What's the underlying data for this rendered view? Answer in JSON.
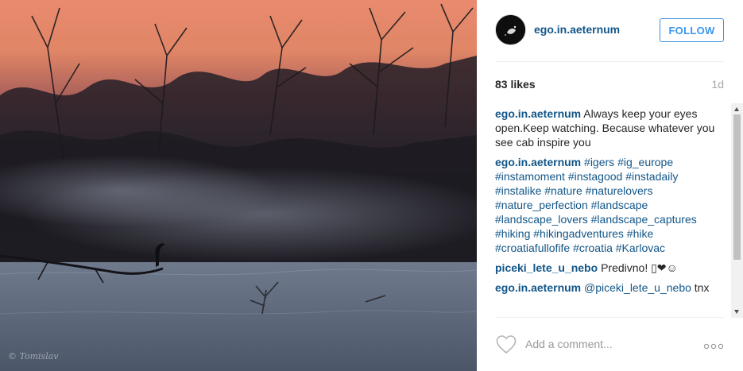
{
  "photo": {
    "watermark": "© Tomislav"
  },
  "post": {
    "author": "ego.in.aeternum",
    "follow_label": "FOLLOW",
    "likes": "83 likes",
    "time_ago": "1d"
  },
  "comments": [
    {
      "user": "ego.in.aeternum",
      "text": "Always keep your eyes open.Keep watching. Because whatever you see cab inspire you"
    },
    {
      "user": "ego.in.aeternum",
      "hashtags": [
        "#igers",
        "#ig_europe",
        "#instamoment",
        "#instagood",
        "#instadaily",
        "#instalike",
        "#nature",
        "#naturelovers",
        "#nature_perfection",
        "#landscape",
        "#landscape_lovers",
        "#landscape_captures",
        "#hiking",
        "#hikingadventures",
        "#hike",
        "#croatiafullofife",
        "#croatia",
        "#Karlovac"
      ]
    },
    {
      "user": "piceki_lete_u_nebo",
      "text": "Predivno! ▯❤☺"
    },
    {
      "user": "ego.in.aeternum",
      "mention": "@piceki_lete_u_nebo",
      "text": "tnx"
    }
  ],
  "footer": {
    "comment_placeholder": "Add a comment...",
    "heart_icon": "heart-outline-icon",
    "more_icon": "more-options-icon"
  },
  "colors": {
    "link": "#125688",
    "follow": "#3897f0",
    "muted": "#a5a7aa"
  }
}
